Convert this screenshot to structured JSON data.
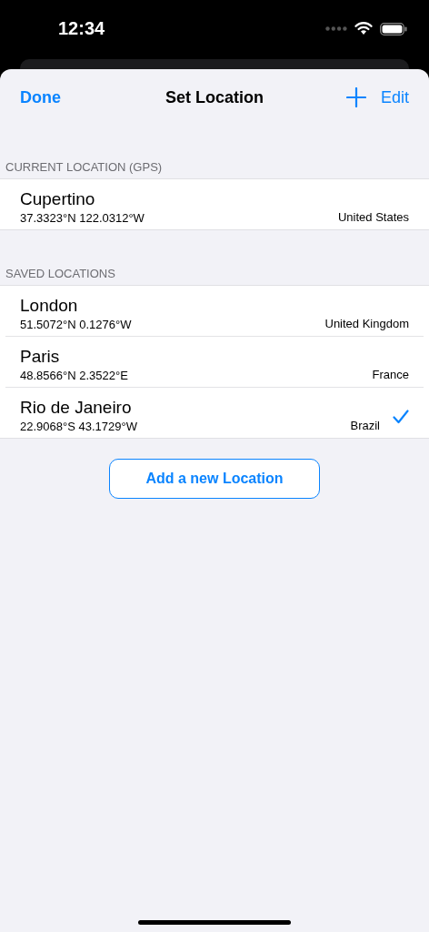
{
  "status_bar": {
    "time": "12:34"
  },
  "nav": {
    "left": "Done",
    "title": "Set Location",
    "right": "Edit"
  },
  "sections": [
    {
      "header": "CURRENT LOCATION (GPS)",
      "rows": [
        {
          "name": "Cupertino",
          "coords": "37.3323°N 122.0312°W",
          "country": "United States",
          "selected": false
        }
      ]
    },
    {
      "header": "SAVED LOCATIONS",
      "rows": [
        {
          "name": "London",
          "coords": "51.5072°N 0.1276°W",
          "country": "United Kingdom",
          "selected": false
        },
        {
          "name": "Paris",
          "coords": "48.8566°N 2.3522°E",
          "country": "France",
          "selected": false
        },
        {
          "name": "Rio de Janeiro",
          "coords": "22.9068°S 43.1729°W",
          "country": "Brazil",
          "selected": true
        }
      ]
    }
  ],
  "add_button": "Add a new Location"
}
